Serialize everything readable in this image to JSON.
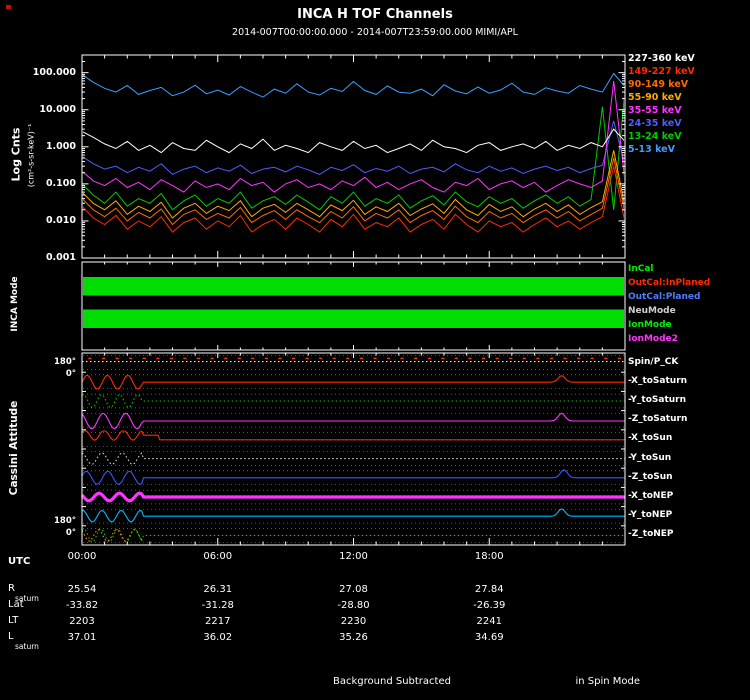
{
  "title": "INCA H TOF Channels",
  "subtitle": "2014-007T00:00:00.000 - 2014-007T23:59:00.000 MIMI/APL",
  "colors": {
    "background": "#000000",
    "foreground": "#ffffff"
  },
  "chart_data": [
    {
      "type": "line",
      "title": "H TOF count rates",
      "ylabel": "Log Cnts",
      "yunits": "(cm²-s-sr-keV)⁻¹",
      "y_scale": "log",
      "ylim": [
        0.001,
        300
      ],
      "y_tick_values": [
        100,
        10,
        1,
        0.1,
        0.01,
        0.001
      ],
      "y_tick_labels": [
        "100.000",
        "10.000",
        "1.000",
        "0.100",
        "0.010",
        "0.001"
      ],
      "x_range_hours": [
        0,
        24
      ],
      "x_tick_hours": [
        0,
        6,
        12,
        18
      ],
      "x_tick_labels": [
        "00:00",
        "06:00",
        "12:00",
        "18:00"
      ],
      "legend_position": "right",
      "series": [
        {
          "name": "227-360 keV",
          "color": "#ffffff",
          "values": [
            2.6,
            1.8,
            1.2,
            0.9,
            1.4,
            0.8,
            1.1,
            0.7,
            1.3,
            0.9,
            0.8,
            1.5,
            1.0,
            0.7,
            1.2,
            0.9,
            1.6,
            0.8,
            1.1,
            0.9,
            0.7,
            1.3,
            1.0,
            0.8,
            1.4,
            0.9,
            1.1,
            0.7,
            0.9,
            1.2,
            0.8,
            1.5,
            1.0,
            0.9,
            0.7,
            1.1,
            1.3,
            0.8,
            1.0,
            1.2,
            0.9,
            1.4,
            0.8,
            1.1,
            0.9,
            1.3,
            1.0,
            3.0,
            1.4
          ]
        },
        {
          "name": "149-227 keV",
          "color": "#ff2a00",
          "values": [
            0.025,
            0.012,
            0.008,
            0.014,
            0.006,
            0.01,
            0.007,
            0.013,
            0.005,
            0.009,
            0.012,
            0.006,
            0.01,
            0.007,
            0.014,
            0.005,
            0.008,
            0.011,
            0.006,
            0.012,
            0.008,
            0.005,
            0.011,
            0.007,
            0.015,
            0.006,
            0.009,
            0.007,
            0.012,
            0.005,
            0.008,
            0.011,
            0.006,
            0.015,
            0.008,
            0.005,
            0.01,
            0.007,
            0.009,
            0.005,
            0.008,
            0.012,
            0.007,
            0.01,
            0.006,
            0.009,
            0.013,
            0.3,
            0.009
          ]
        },
        {
          "name": "90-149 keV",
          "color": "#ff6a00",
          "values": [
            0.04,
            0.02,
            0.013,
            0.022,
            0.01,
            0.017,
            0.012,
            0.021,
            0.008,
            0.015,
            0.02,
            0.011,
            0.016,
            0.012,
            0.023,
            0.009,
            0.014,
            0.019,
            0.011,
            0.02,
            0.013,
            0.009,
            0.018,
            0.012,
            0.024,
            0.01,
            0.016,
            0.012,
            0.02,
            0.009,
            0.014,
            0.019,
            0.011,
            0.025,
            0.013,
            0.009,
            0.018,
            0.012,
            0.016,
            0.009,
            0.014,
            0.02,
            0.012,
            0.018,
            0.01,
            0.015,
            0.022,
            0.5,
            0.016
          ]
        },
        {
          "name": "55-90 keV",
          "color": "#ffaa00",
          "values": [
            0.06,
            0.03,
            0.02,
            0.035,
            0.015,
            0.025,
            0.018,
            0.032,
            0.012,
            0.022,
            0.03,
            0.016,
            0.025,
            0.019,
            0.035,
            0.013,
            0.022,
            0.028,
            0.017,
            0.03,
            0.02,
            0.013,
            0.027,
            0.019,
            0.036,
            0.015,
            0.024,
            0.018,
            0.03,
            0.014,
            0.021,
            0.029,
            0.016,
            0.038,
            0.02,
            0.014,
            0.028,
            0.018,
            0.024,
            0.013,
            0.021,
            0.03,
            0.018,
            0.027,
            0.015,
            0.023,
            0.033,
            0.8,
            0.024
          ]
        },
        {
          "name": "35-55 keV",
          "color": "#ff33ff",
          "values": [
            0.22,
            0.12,
            0.09,
            0.14,
            0.08,
            0.11,
            0.07,
            0.13,
            0.09,
            0.06,
            0.12,
            0.08,
            0.1,
            0.07,
            0.14,
            0.09,
            0.11,
            0.06,
            0.1,
            0.13,
            0.08,
            0.1,
            0.07,
            0.12,
            0.09,
            0.15,
            0.08,
            0.11,
            0.07,
            0.1,
            0.13,
            0.08,
            0.06,
            0.11,
            0.09,
            0.14,
            0.07,
            0.1,
            0.12,
            0.08,
            0.11,
            0.06,
            0.09,
            0.13,
            0.1,
            0.08,
            0.12,
            60,
            0.11
          ]
        },
        {
          "name": "24-35 keV",
          "color": "#4d5cff",
          "values": [
            0.55,
            0.35,
            0.25,
            0.3,
            0.2,
            0.28,
            0.22,
            0.35,
            0.18,
            0.25,
            0.3,
            0.2,
            0.27,
            0.22,
            0.32,
            0.19,
            0.25,
            0.28,
            0.21,
            0.3,
            0.24,
            0.18,
            0.28,
            0.23,
            0.33,
            0.2,
            0.26,
            0.22,
            0.3,
            0.19,
            0.25,
            0.28,
            0.21,
            0.35,
            0.24,
            0.2,
            0.3,
            0.22,
            0.27,
            0.19,
            0.25,
            0.3,
            0.23,
            0.28,
            0.2,
            0.26,
            0.32,
            5.0,
            0.3
          ]
        },
        {
          "name": "13-24 keV",
          "color": "#00cc00",
          "values": [
            0.1,
            0.05,
            0.03,
            0.06,
            0.025,
            0.04,
            0.03,
            0.055,
            0.02,
            0.035,
            0.05,
            0.025,
            0.04,
            0.03,
            0.06,
            0.022,
            0.035,
            0.045,
            0.028,
            0.05,
            0.032,
            0.02,
            0.045,
            0.03,
            0.06,
            0.025,
            0.04,
            0.03,
            0.05,
            0.022,
            0.035,
            0.048,
            0.027,
            0.06,
            0.033,
            0.024,
            0.045,
            0.03,
            0.04,
            0.022,
            0.035,
            0.05,
            0.03,
            0.045,
            0.025,
            0.038,
            12,
            0.02,
            35
          ]
        },
        {
          "name": "5-13 keV",
          "color": "#3aa0ff",
          "values": [
            90,
            55,
            38,
            30,
            45,
            26,
            33,
            40,
            24,
            30,
            46,
            27,
            34,
            25,
            42,
            30,
            22,
            36,
            28,
            50,
            30,
            25,
            38,
            31,
            58,
            33,
            26,
            44,
            30,
            28,
            36,
            24,
            47,
            32,
            27,
            41,
            28,
            34,
            52,
            30,
            26,
            39,
            32,
            28,
            45,
            36,
            30,
            95,
            42
          ]
        }
      ]
    },
    {
      "type": "interval",
      "title": "INCA Mode",
      "legend": [
        {
          "label": "InCal",
          "color": "#00ee00"
        },
        {
          "label": "OutCal:InPlaned",
          "color": "#ff2a00"
        },
        {
          "label": "OutCal:Planed",
          "color": "#4d7cff"
        },
        {
          "label": "NeuMode",
          "color": "#cfcfcf"
        },
        {
          "label": "IonMode",
          "color": "#00ee00"
        },
        {
          "label": "IonMode2",
          "color": "#ff33ff"
        }
      ],
      "bars": [
        {
          "color": "#00dd00",
          "t_start": 0,
          "t_end": 24,
          "band": [
            0.17,
            0.38
          ]
        },
        {
          "color": "#00dd00",
          "t_start": 0,
          "t_end": 24,
          "band": [
            0.54,
            0.75
          ]
        }
      ]
    },
    {
      "type": "line",
      "title": "Cassini Attitude",
      "y_axis_labels": [
        "180°",
        "0°",
        "180°",
        "0°"
      ],
      "rows": [
        {
          "label": "Spin/P_CK",
          "color": "#e8e8e8",
          "style": "dotted",
          "level": 0.55,
          "wiggle_amp": 0,
          "wiggle_period": 1,
          "wiggle_end": 0,
          "phase": 0,
          "bump": 0,
          "bump_hour": 0,
          "marks": {
            "color": "#ff3300",
            "interval_hours": 0.6,
            "level": 0.72
          }
        },
        {
          "label": "-X_toSaturn",
          "color": "#ff2a00",
          "style": "solid",
          "level": 0.48,
          "wiggle_amp": 0.36,
          "wiggle_period": 0.9,
          "wiggle_end": 2.7,
          "phase": 0,
          "bump": 0.34,
          "bump_hour": 21.2
        },
        {
          "label": "-Y_toSaturn",
          "color": "#00cc00",
          "style": "dotted",
          "level": 0.5,
          "wiggle_amp": 0.34,
          "wiggle_period": 0.8,
          "wiggle_end": 2.7,
          "phase": 1.1,
          "bump": 0,
          "bump_hour": 0
        },
        {
          "label": "-Z_toSaturn",
          "color": "#ff33ff",
          "style": "solid",
          "level": 0.46,
          "wiggle_amp": 0.4,
          "wiggle_period": 1.0,
          "wiggle_end": 2.7,
          "phase": 2.0,
          "bump": 0.4,
          "bump_hour": 21.2
        },
        {
          "label": "-X_toSun",
          "color": "#ff2a00",
          "style": "solid",
          "level": 0.72,
          "level2": 0.48,
          "step_hour": 3.4,
          "wiggle_amp": 0.26,
          "wiggle_period": 0.85,
          "wiggle_end": 2.7,
          "phase": 0.6,
          "bump": 0,
          "bump_hour": 0
        },
        {
          "label": "-Y_toSun",
          "color": "#d8d8d8",
          "style": "dotted",
          "level": 0.5,
          "wiggle_amp": 0.3,
          "wiggle_period": 0.9,
          "wiggle_end": 2.7,
          "phase": 1.7,
          "bump": 0,
          "bump_hour": 0
        },
        {
          "label": "-Z_toSun",
          "color": "#3a55ff",
          "style": "solid",
          "level": 0.5,
          "wiggle_amp": 0.34,
          "wiggle_period": 0.95,
          "wiggle_end": 2.7,
          "phase": 0.3,
          "bump": 0.42,
          "bump_hour": 21.3
        },
        {
          "label": "-X_toNEP",
          "color": "#ff33ff",
          "style": "solid",
          "width": 3.2,
          "level": 0.5,
          "wiggle_amp": 0.2,
          "wiggle_period": 0.9,
          "wiggle_end": 2.7,
          "phase": 2.6,
          "bump": 0,
          "bump_hour": 0
        },
        {
          "label": "-Y_toNEP",
          "color": "#00bbff",
          "style": "solid",
          "level": 0.5,
          "wiggle_amp": 0.3,
          "wiggle_period": 0.85,
          "wiggle_end": 2.7,
          "phase": 1.3,
          "bump": 0.38,
          "bump_hour": 21.2
        },
        {
          "label": "-Z_toNEP",
          "color": "#00cc00",
          "style": "dotted",
          "level": 0.5,
          "wiggle_amp": 0.34,
          "wiggle_period": 0.75,
          "wiggle_end": 2.7,
          "phase": 0.9,
          "bump": 0,
          "bump_hour": 0,
          "companion": {
            "color": "#ff8800",
            "style": "dotted",
            "wiggle_amp": 0.3,
            "wiggle_period": 0.8,
            "phase": 2.2
          }
        }
      ]
    }
  ],
  "bottom": {
    "utc_label": "UTC",
    "tick_hours": [
      0,
      6,
      12,
      18
    ],
    "tick_labels": [
      "00:00",
      "06:00",
      "12:00",
      "18:00"
    ],
    "rows": [
      {
        "label": "R",
        "sub": "saturn",
        "values": [
          "25.54",
          "26.31",
          "27.08",
          "27.84"
        ]
      },
      {
        "label": "Lat",
        "sub": "",
        "values": [
          "-33.82",
          "-31.28",
          "-28.80",
          "-26.39"
        ]
      },
      {
        "label": "LT",
        "sub": "",
        "values": [
          "2203",
          "2217",
          "2230",
          "2241"
        ]
      },
      {
        "label": "L",
        "sub": "saturn",
        "values": [
          "37.01",
          "36.02",
          "35.26",
          "34.69"
        ]
      }
    ]
  },
  "footer": {
    "left": "Background Subtracted",
    "right": "in Spin Mode"
  }
}
